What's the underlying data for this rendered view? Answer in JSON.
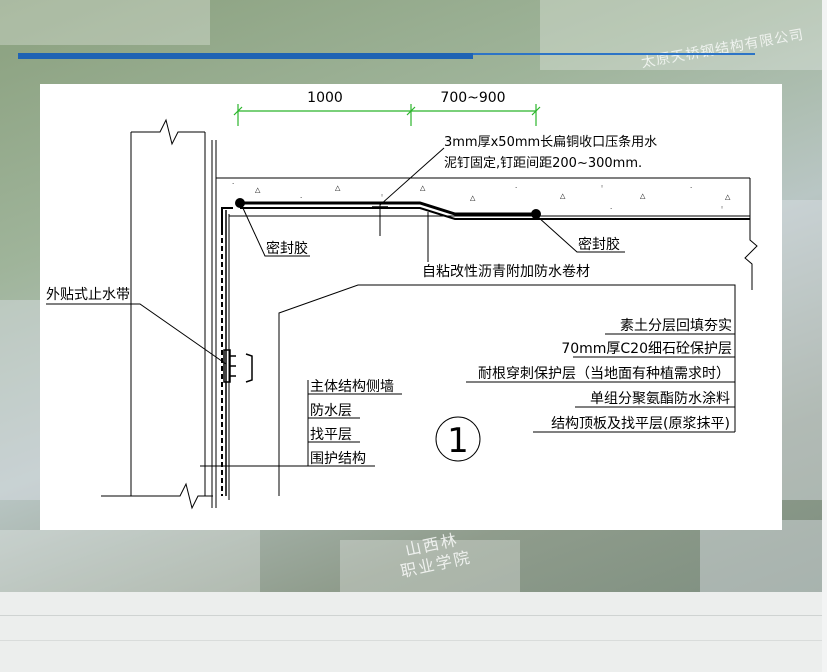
{
  "slide": {
    "watermark_top": "太原天桥钢结构有限公司",
    "watermark_bottom_1": "山西林",
    "watermark_bottom_2": "职业学院",
    "accent_color": "#1f63b4",
    "line_color": "#2bb52b"
  },
  "diagram": {
    "dim_1": "1000",
    "dim_2": "700~900",
    "note_top_1": "3mm厚x50mm长扁铜收口压条用水",
    "note_top_2": "泥钉固定,钉距间距200~300mm.",
    "sealant_left": "密封胶",
    "sealant_right": "密封胶",
    "membrane": "自粘改性沥青附加防水卷材",
    "waterstop": "外贴式止水带",
    "layers_right": [
      "素土分层回填夯实",
      "70mm厚C20细石砼保护层",
      "耐根穿刺保护层（当地面有种植需求时）",
      "单组分聚氨酯防水涂料",
      "结构顶板及找平层(原浆抹平)"
    ],
    "layers_left": [
      "主体结构侧墙",
      "防水层",
      "找平层",
      "围护结构"
    ],
    "circle_number": "1"
  }
}
